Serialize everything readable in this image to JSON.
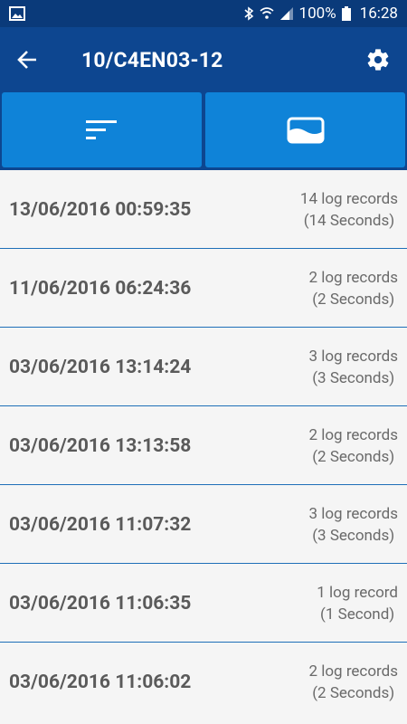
{
  "status_bar": {
    "battery": "100%",
    "time": "16:28"
  },
  "app_bar": {
    "title": "10/C4EN03-12",
    "back_icon": "arrow-back-icon",
    "settings_icon": "gear-icon"
  },
  "toolbar": {
    "left_icon": "sort-icon",
    "right_icon": "storage-icon"
  },
  "records": [
    {
      "datetime": "13/06/2016 00:59:35",
      "count": "14 log records",
      "duration": "(14 Seconds)"
    },
    {
      "datetime": "11/06/2016 06:24:36",
      "count": "2 log records",
      "duration": "(2 Seconds)"
    },
    {
      "datetime": "03/06/2016 13:14:24",
      "count": "3 log records",
      "duration": "(3 Seconds)"
    },
    {
      "datetime": "03/06/2016 13:13:58",
      "count": "2 log records",
      "duration": "(2 Seconds)"
    },
    {
      "datetime": "03/06/2016 11:07:32",
      "count": "3 log records",
      "duration": "(3 Seconds)"
    },
    {
      "datetime": "03/06/2016 11:06:35",
      "count": "1 log record",
      "duration": "(1 Second)"
    },
    {
      "datetime": "03/06/2016 11:06:02",
      "count": "2 log records",
      "duration": "(2 Seconds)"
    }
  ],
  "colors": {
    "status_bar": "#0a3a7a",
    "app_bar": "#0d4690",
    "toolbar_button": "#0f83d8",
    "divider": "#1e6fb8"
  }
}
